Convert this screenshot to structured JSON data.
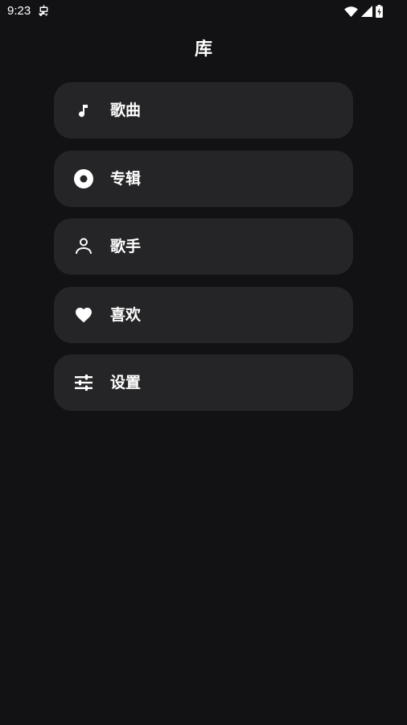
{
  "status_bar": {
    "time": "9:23",
    "icons": [
      "debug-icon",
      "wifi-icon",
      "cellular-signal-icon",
      "battery-charging-icon"
    ]
  },
  "page": {
    "title": "库"
  },
  "menu": {
    "items": [
      {
        "label": "歌曲",
        "icon": "music-note-icon"
      },
      {
        "label": "专辑",
        "icon": "album-disc-icon"
      },
      {
        "label": "歌手",
        "icon": "person-icon"
      },
      {
        "label": "喜欢",
        "icon": "heart-icon"
      },
      {
        "label": "设置",
        "icon": "settings-sliders-icon"
      }
    ]
  },
  "colors": {
    "background": "#121214",
    "card": "#252527",
    "text": "#ffffff"
  }
}
